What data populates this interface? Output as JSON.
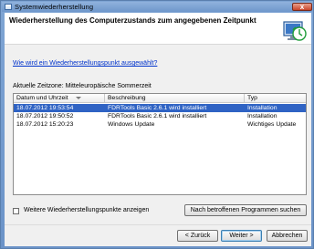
{
  "window": {
    "title": "Systemwiederherstellung",
    "close_label": "x"
  },
  "header": {
    "title": "Wiederherstellung des Computerzustands zum angegebenen Zeitpunkt"
  },
  "link_text": "Wie wird ein Wiederherstellungspunkt ausgewählt?",
  "timezone_text": "Aktuelle Zeitzone: Mitteleuropäische Sommerzeit",
  "list": {
    "columns": [
      "Datum und Uhrzeit",
      "Beschreibung",
      "Typ"
    ],
    "rows": [
      {
        "date": "18.07.2012 19:53:54",
        "description": "FDRTools Basic 2.6.1 wird installiert",
        "type": "Installation",
        "selected": true
      },
      {
        "date": "18.07.2012 19:50:52",
        "description": "FDRTools Basic 2.6.1 wird installiert",
        "type": "Installation",
        "selected": false
      },
      {
        "date": "18.07.2012 15:20:23",
        "description": "Windows Update",
        "type": "Wichtiges Update",
        "selected": false
      }
    ]
  },
  "checkbox_label": "Weitere Wiederherstellungspunkte anzeigen",
  "buttons": {
    "scan": "Nach betroffenen Programmen suchen",
    "back": "< Zurück",
    "next": "Weiter >",
    "cancel": "Abbrechen"
  },
  "colors": {
    "selection": "#2f63c4",
    "link": "#0033cc",
    "titlebar": "#7fa5d4"
  }
}
